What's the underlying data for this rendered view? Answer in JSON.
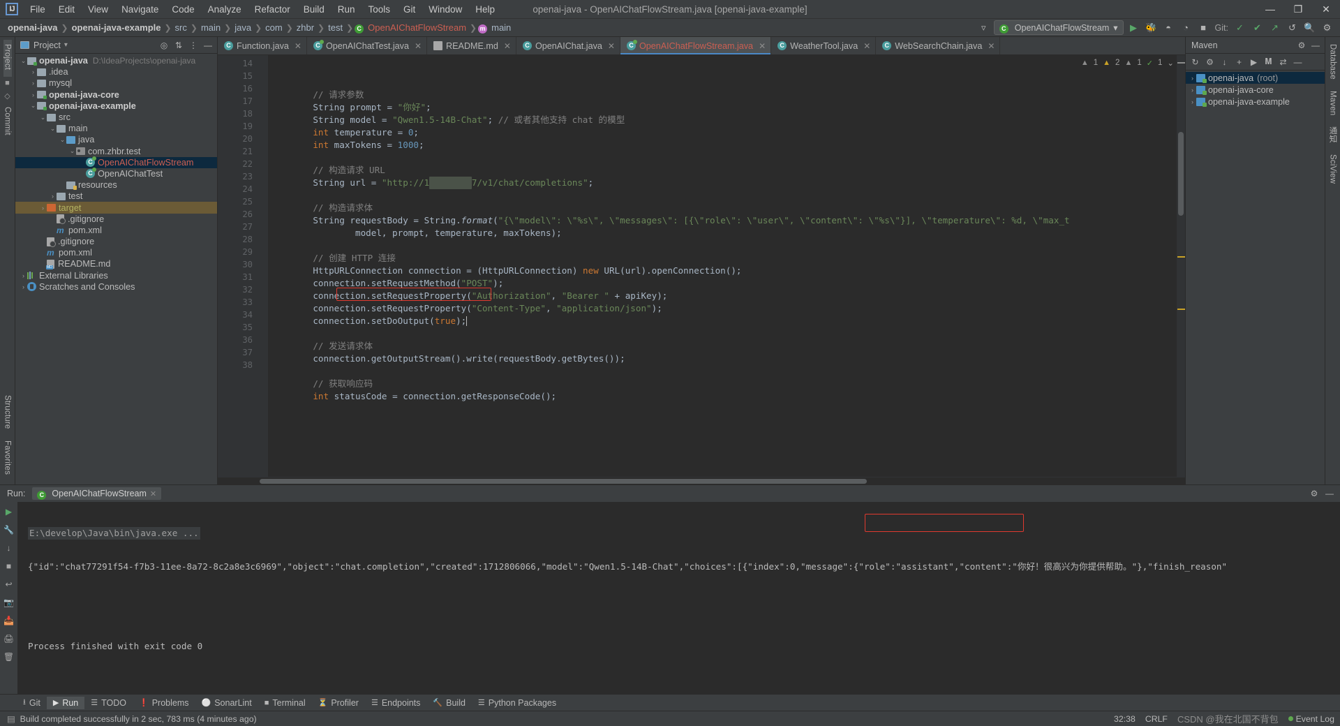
{
  "window": {
    "title": "openai-java - OpenAIChatFlowStream.java [openai-java-example]",
    "logo": "IJ",
    "minimize": "—",
    "maximize": "❐",
    "close": "✕"
  },
  "menu": [
    "File",
    "Edit",
    "View",
    "Navigate",
    "Code",
    "Analyze",
    "Refactor",
    "Build",
    "Run",
    "Tools",
    "Git",
    "Window",
    "Help"
  ],
  "breadcrumb": {
    "items": [
      {
        "label": "openai-java",
        "style": "bold"
      },
      {
        "label": "openai-java-example",
        "style": "bold"
      },
      {
        "label": "src",
        "style": "plain"
      },
      {
        "label": "main",
        "style": "plain"
      },
      {
        "label": "java",
        "style": "plain"
      },
      {
        "label": "com",
        "style": "plain"
      },
      {
        "label": "zhbr",
        "style": "plain"
      },
      {
        "label": "test",
        "style": "plain"
      },
      {
        "label": "OpenAIChatFlowStream",
        "style": "red",
        "icon": "class-icon"
      },
      {
        "label": "main",
        "style": "plain",
        "icon": "method-icon"
      }
    ],
    "separator": "❯",
    "run_config": "OpenAIChatFlowStream",
    "git_label": "Git:"
  },
  "toolbar_right": {
    "run": "▶",
    "debug": "🐞",
    "coverage": "◷",
    "profiler": "◴",
    "stop": "■",
    "git_update": "✓",
    "git_commit": "✔",
    "git_push": "↗",
    "git_history": "↺",
    "search": "🔍",
    "settings": "⚙"
  },
  "left_rail": {
    "project": "Project",
    "commit": "Commit",
    "structure": "Structure",
    "favorites": "Favorites",
    "git": "Git"
  },
  "right_rail": {
    "database": "Database",
    "maven": "Maven",
    "notifications": "通知",
    "sciview": "SciView"
  },
  "project_panel": {
    "title": "Project",
    "chevron": "▾",
    "actions": [
      "locate-icon",
      "expand-icon",
      "collapse-icon",
      "hide-icon"
    ],
    "tree": [
      {
        "indent": 0,
        "arrow": "⌄",
        "icon": "module-folder",
        "label": "openai-java",
        "style": "bold",
        "path": "D:\\IdeaProjects\\openai-java"
      },
      {
        "indent": 1,
        "arrow": "›",
        "icon": "folder",
        "label": ".idea",
        "style": "plain",
        "path": ""
      },
      {
        "indent": 1,
        "arrow": "›",
        "icon": "folder",
        "label": "mysql",
        "style": "plain",
        "path": ""
      },
      {
        "indent": 1,
        "arrow": "›",
        "icon": "module-folder",
        "label": "openai-java-core",
        "style": "bold",
        "path": ""
      },
      {
        "indent": 1,
        "arrow": "⌄",
        "icon": "module-folder",
        "label": "openai-java-example",
        "style": "bold",
        "path": ""
      },
      {
        "indent": 2,
        "arrow": "⌄",
        "icon": "folder",
        "label": "src",
        "style": "plain",
        "path": ""
      },
      {
        "indent": 3,
        "arrow": "⌄",
        "icon": "folder",
        "label": "main",
        "style": "plain",
        "path": ""
      },
      {
        "indent": 4,
        "arrow": "⌄",
        "icon": "source-folder",
        "label": "java",
        "style": "plain",
        "path": ""
      },
      {
        "indent": 5,
        "arrow": "⌄",
        "icon": "package",
        "label": "com.zhbr.test",
        "style": "plain",
        "path": ""
      },
      {
        "indent": 6,
        "arrow": "",
        "icon": "java-class-run",
        "label": "OpenAIChatFlowStream",
        "style": "red",
        "selected": true,
        "path": ""
      },
      {
        "indent": 6,
        "arrow": "",
        "icon": "java-class-run",
        "label": "OpenAIChatTest",
        "style": "plain",
        "path": ""
      },
      {
        "indent": 4,
        "arrow": "",
        "icon": "resources-folder",
        "label": "resources",
        "style": "plain",
        "path": ""
      },
      {
        "indent": 3,
        "arrow": "›",
        "icon": "folder",
        "label": "test",
        "style": "plain",
        "path": ""
      },
      {
        "indent": 2,
        "arrow": "›",
        "icon": "target-folder",
        "label": "target",
        "style": "target",
        "highlight": true,
        "path": ""
      },
      {
        "indent": 3,
        "arrow": "",
        "icon": "gitignore-file",
        "label": ".gitignore",
        "style": "plain",
        "path": ""
      },
      {
        "indent": 3,
        "arrow": "",
        "icon": "maven-file",
        "label": "pom.xml",
        "style": "plain",
        "path": ""
      },
      {
        "indent": 2,
        "arrow": "",
        "icon": "gitignore-file",
        "label": ".gitignore",
        "style": "plain",
        "path": ""
      },
      {
        "indent": 2,
        "arrow": "",
        "icon": "maven-file",
        "label": "pom.xml",
        "style": "plain",
        "path": ""
      },
      {
        "indent": 2,
        "arrow": "",
        "icon": "markdown-file",
        "label": "README.md",
        "style": "plain",
        "path": ""
      },
      {
        "indent": 0,
        "arrow": "›",
        "icon": "library-icon",
        "label": "External Libraries",
        "style": "plain",
        "path": ""
      },
      {
        "indent": 0,
        "arrow": "›",
        "icon": "scratches-icon",
        "label": "Scratches and Consoles",
        "style": "plain",
        "path": ""
      }
    ]
  },
  "editor": {
    "tabs": [
      {
        "label": "Function.java",
        "icon": "java-class-icon",
        "active": false
      },
      {
        "label": "OpenAIChatTest.java",
        "icon": "java-class-run-icon",
        "active": false
      },
      {
        "label": "README.md",
        "icon": "markdown-icon",
        "active": false
      },
      {
        "label": "OpenAIChat.java",
        "icon": "java-class-icon",
        "active": false
      },
      {
        "label": "OpenAIChatFlowStream.java",
        "icon": "java-class-run-icon",
        "active": true
      },
      {
        "label": "WeatherTool.java",
        "icon": "java-class-icon",
        "active": false
      },
      {
        "label": "WebSearchChain.java",
        "icon": "java-class-icon",
        "active": false
      }
    ],
    "tab_close": "✕",
    "inspections": {
      "error_count": "1",
      "warning_count": "2",
      "weak_count": "1",
      "ok_count": "1",
      "chevron": "⌄"
    },
    "first_line_number": 14,
    "lines": [
      {
        "n": 14,
        "segments": [
          {
            "t": "    ",
            "c": ""
          },
          {
            "t": "// 请求参数",
            "c": "cmt"
          }
        ]
      },
      {
        "n": 15,
        "segments": [
          {
            "t": "    ",
            "c": ""
          },
          {
            "t": "String",
            "c": "typ"
          },
          {
            "t": " prompt = ",
            "c": ""
          },
          {
            "t": "\"你好\"",
            "c": "str"
          },
          {
            "t": ";",
            "c": ""
          }
        ]
      },
      {
        "n": 16,
        "segments": [
          {
            "t": "    ",
            "c": ""
          },
          {
            "t": "String",
            "c": "typ"
          },
          {
            "t": " model = ",
            "c": ""
          },
          {
            "t": "\"Qwen1.5-14B-Chat\"",
            "c": "str"
          },
          {
            "t": "; ",
            "c": ""
          },
          {
            "t": "// 或者其他支持 chat 的模型",
            "c": "cmt"
          }
        ]
      },
      {
        "n": 17,
        "segments": [
          {
            "t": "    ",
            "c": ""
          },
          {
            "t": "int",
            "c": "kw"
          },
          {
            "t": " temperature = ",
            "c": ""
          },
          {
            "t": "0",
            "c": "num"
          },
          {
            "t": ";",
            "c": ""
          }
        ]
      },
      {
        "n": 18,
        "segments": [
          {
            "t": "    ",
            "c": ""
          },
          {
            "t": "int",
            "c": "kw"
          },
          {
            "t": " maxTokens = ",
            "c": ""
          },
          {
            "t": "1000",
            "c": "num"
          },
          {
            "t": ";",
            "c": ""
          }
        ]
      },
      {
        "n": 19,
        "segments": []
      },
      {
        "n": 20,
        "segments": [
          {
            "t": "    ",
            "c": ""
          },
          {
            "t": "// 构造请求 URL",
            "c": "cmt"
          }
        ]
      },
      {
        "n": 21,
        "segments": [
          {
            "t": "    ",
            "c": ""
          },
          {
            "t": "String",
            "c": "typ"
          },
          {
            "t": " url = ",
            "c": ""
          },
          {
            "t": "\"http://1",
            "c": "str"
          },
          {
            "t": "REDACTED",
            "c": "blk"
          },
          {
            "t": "7/v1/chat/completions\"",
            "c": "str"
          },
          {
            "t": ";",
            "c": ""
          }
        ]
      },
      {
        "n": 22,
        "segments": []
      },
      {
        "n": 23,
        "segments": [
          {
            "t": "    ",
            "c": ""
          },
          {
            "t": "// 构造请求体",
            "c": "cmt"
          }
        ]
      },
      {
        "n": 24,
        "segments": [
          {
            "t": "    ",
            "c": ""
          },
          {
            "t": "String",
            "c": "typ"
          },
          {
            "t": " requestBody = ",
            "c": ""
          },
          {
            "t": "String",
            "c": "typ"
          },
          {
            "t": ".",
            "c": ""
          },
          {
            "t": "format",
            "c": "ital"
          },
          {
            "t": "(",
            "c": ""
          },
          {
            "t": "\"{\\\"model\\\": \\\"%s\\\", \\\"messages\\\": [{\\\"role\\\": \\\"user\\\", \\\"content\\\": \\\"%s\\\"}], \\\"temperature\\\": %d, \\\"max_t",
            "c": "str"
          }
        ]
      },
      {
        "n": 25,
        "segments": [
          {
            "t": "            model, prompt, temperature, maxTokens);",
            "c": ""
          }
        ]
      },
      {
        "n": 26,
        "segments": []
      },
      {
        "n": 27,
        "segments": [
          {
            "t": "    ",
            "c": ""
          },
          {
            "t": "// 创建 HTTP 连接",
            "c": "cmt"
          }
        ]
      },
      {
        "n": 28,
        "segments": [
          {
            "t": "    ",
            "c": ""
          },
          {
            "t": "HttpURLConnection",
            "c": "typ"
          },
          {
            "t": " connection = (HttpURLConnection) ",
            "c": ""
          },
          {
            "t": "new",
            "c": "kw"
          },
          {
            "t": " URL(url).openConnection();",
            "c": ""
          }
        ]
      },
      {
        "n": 29,
        "segments": [
          {
            "t": "    connection.setRequestMethod(",
            "c": ""
          },
          {
            "t": "\"POST\"",
            "c": "str"
          },
          {
            "t": ");",
            "c": ""
          }
        ]
      },
      {
        "n": 30,
        "segments": [
          {
            "t": "    connection.setRequestProperty(",
            "c": ""
          },
          {
            "t": "\"Authorization\"",
            "c": "str"
          },
          {
            "t": ", ",
            "c": ""
          },
          {
            "t": "\"Bearer \"",
            "c": "str"
          },
          {
            "t": " + apiKey);",
            "c": ""
          }
        ]
      },
      {
        "n": 31,
        "segments": [
          {
            "t": "    connection.setRequestProperty(",
            "c": ""
          },
          {
            "t": "\"Content-Type\"",
            "c": "str"
          },
          {
            "t": ", ",
            "c": ""
          },
          {
            "t": "\"application/json\"",
            "c": "str"
          },
          {
            "t": ");",
            "c": ""
          }
        ]
      },
      {
        "n": 32,
        "segments": [
          {
            "t": "    connection.setDoOutput(",
            "c": ""
          },
          {
            "t": "true",
            "c": "kw"
          },
          {
            "t": ");",
            "c": ""
          }
        ],
        "boxed": true
      },
      {
        "n": 33,
        "segments": []
      },
      {
        "n": 34,
        "segments": [
          {
            "t": "    ",
            "c": ""
          },
          {
            "t": "// 发送请求体",
            "c": "cmt"
          }
        ]
      },
      {
        "n": 35,
        "segments": [
          {
            "t": "    connection.getOutputStream().write(requestBody.getBytes());",
            "c": ""
          }
        ]
      },
      {
        "n": 36,
        "segments": []
      },
      {
        "n": 37,
        "segments": [
          {
            "t": "    ",
            "c": ""
          },
          {
            "t": "// 获取响应码",
            "c": "cmt"
          }
        ]
      },
      {
        "n": 38,
        "segments": [
          {
            "t": "    ",
            "c": ""
          },
          {
            "t": "int",
            "c": "kw"
          },
          {
            "t": " statusCode = connection.getResponseCode();",
            "c": ""
          }
        ]
      }
    ]
  },
  "maven_panel": {
    "title": "Maven",
    "toolbar": [
      "reload-icon",
      "generate-sources-icon",
      "download-sources-icon",
      "add-icon",
      "run-icon",
      "toggle-offline-icon",
      "skip-tests-icon",
      "collapse-icon"
    ],
    "tree": [
      {
        "label": "openai-java",
        "suffix": "(root)",
        "arrow": "›",
        "selected": true
      },
      {
        "label": "openai-java-core",
        "suffix": "",
        "arrow": "›",
        "selected": false
      },
      {
        "label": "openai-java-example",
        "suffix": "",
        "arrow": "›",
        "selected": false
      }
    ]
  },
  "run_panel": {
    "label": "Run:",
    "tab": "OpenAIChatFlowStream",
    "tab_close": "✕",
    "actions": [
      "settings-icon",
      "hide-icon"
    ],
    "toolbar": [
      "rerun-icon",
      "wrench-icon",
      "scroll-up-icon",
      "stop-icon",
      "trash-icon",
      "wrap-icon",
      "camera-icon",
      "export-icon",
      "print-icon"
    ],
    "console": {
      "command": "E:\\develop\\Java\\bin\\java.exe ...",
      "json_before": "{\"id\":\"chat77291f54-f7b3-11ee-8a72-8c2a8e3c6969\",\"object\":\"chat.completion\",\"created\":1712806066,\"model\":\"Qwen1.5-14B-Chat\",\"choices\":[{\"index\":0,\"message\":{\"role\":\"assistant\",",
      "json_highlight": "\"content\":\"你好！很高兴为你提供帮助。\"},",
      "json_after": "\"finish_reason\"",
      "exit_line": "Process finished with exit code 0"
    }
  },
  "tool_window_bar": [
    {
      "label": "Git",
      "icon": "git-branch-icon",
      "active": false
    },
    {
      "label": "Run",
      "icon": "run-icon",
      "active": true
    },
    {
      "label": "TODO",
      "icon": "todo-icon",
      "active": false
    },
    {
      "label": "Problems",
      "icon": "problems-icon",
      "active": false
    },
    {
      "label": "SonarLint",
      "icon": "sonarlint-icon",
      "active": false
    },
    {
      "label": "Terminal",
      "icon": "terminal-icon",
      "active": false
    },
    {
      "label": "Profiler",
      "icon": "profiler-icon",
      "active": false
    },
    {
      "label": "Endpoints",
      "icon": "endpoints-icon",
      "active": false
    },
    {
      "label": "Build",
      "icon": "build-icon",
      "active": false
    },
    {
      "label": "Python Packages",
      "icon": "python-packages-icon",
      "active": false
    }
  ],
  "statusbar": {
    "message": "Build completed successfully in 2 sec, 783 ms (4 minutes ago)",
    "caret_position": "32:38",
    "line_separator": "CRLF",
    "watermark": "CSDN @我在北国不背包",
    "event_log": "Event Log"
  }
}
